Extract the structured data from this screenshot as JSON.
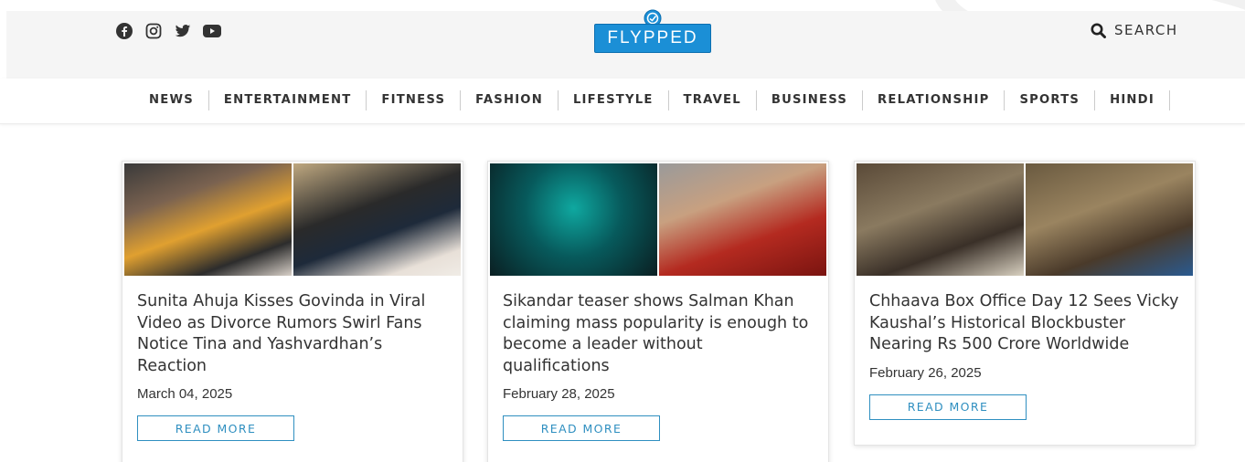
{
  "header": {
    "social": [
      {
        "icon": "facebook-icon"
      },
      {
        "icon": "instagram-icon"
      },
      {
        "icon": "twitter-icon"
      },
      {
        "icon": "youtube-icon"
      }
    ],
    "logo_text": "FLYPPED",
    "search_label": "SEARCH"
  },
  "nav": {
    "items": [
      "NEWS",
      "ENTERTAINMENT",
      "FITNESS",
      "FASHION",
      "LIFESTYLE",
      "TRAVEL",
      "BUSINESS",
      "RELATIONSHIP",
      "SPORTS",
      "HINDI"
    ]
  },
  "articles": [
    {
      "title": "Sunita Ahuja Kisses Govinda in Viral Video as Divorce Rumors Swirl Fans Notice Tina and Yashvardhan’s Reaction",
      "date": "March 04, 2025",
      "button": "READ MORE"
    },
    {
      "title": "Sikandar teaser shows Salman Khan claiming mass popularity is enough to become a leader without qualifications",
      "date": "February 28, 2025",
      "button": "READ MORE"
    },
    {
      "title": "Chhaava Box Office Day 12 Sees Vicky Kaushal’s Historical Blockbuster Nearing Rs 500 Crore Worldwide",
      "date": "February 26, 2025",
      "button": "READ MORE"
    }
  ],
  "colors": {
    "accent": "#2f8fc0",
    "logo": "#1b8fd6",
    "header_bg": "#f5f5f5",
    "text": "#333333"
  }
}
